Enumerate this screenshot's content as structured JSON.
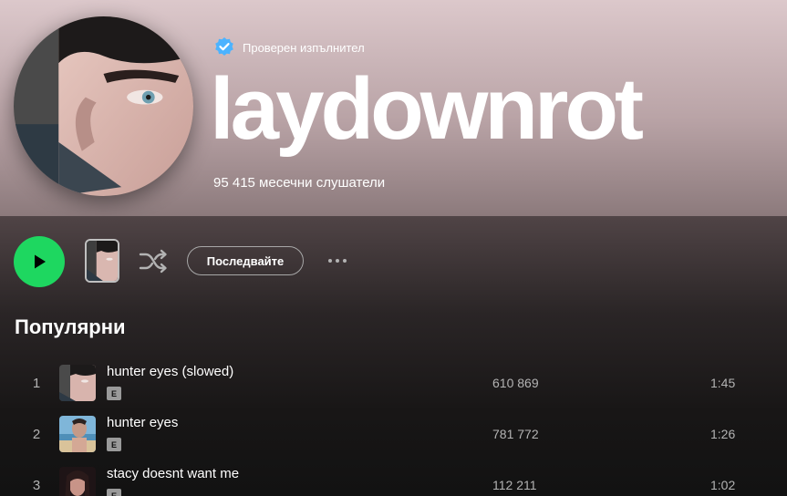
{
  "header": {
    "verified_label": "Проверен изпълнител",
    "artist_name": "laydownrot",
    "monthly_listeners": "95 415 месечни слушатели"
  },
  "actions": {
    "follow_label": "Последвайте",
    "play_icon": "play-icon",
    "shuffle_icon": "shuffle-icon",
    "more_icon": "more-options-icon"
  },
  "popular": {
    "title": "Популярни",
    "tracks": [
      {
        "number": "1",
        "title": "hunter eyes (slowed)",
        "explicit": "E",
        "plays": "610 869",
        "duration": "1:45"
      },
      {
        "number": "2",
        "title": "hunter eyes",
        "explicit": "E",
        "plays": "781 772",
        "duration": "1:26"
      },
      {
        "number": "3",
        "title": "stacy doesnt want me",
        "explicit": "E",
        "plays": "112 211",
        "duration": "1:02"
      }
    ]
  },
  "colors": {
    "accent": "#1ed760",
    "verified_blue": "#4cb3ff",
    "background": "#121212",
    "secondary_text": "#b3b3b3"
  }
}
